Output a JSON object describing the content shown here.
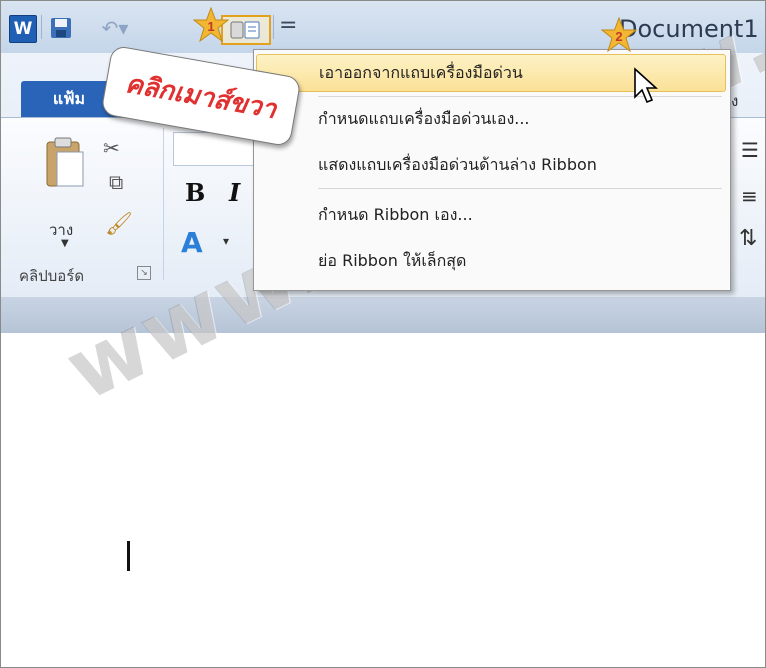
{
  "window": {
    "title": "Document1",
    "app_icon_letter": "W"
  },
  "ribbon": {
    "file_tab": "แฟ้ม",
    "right_tab_fragment": "ง",
    "clipboard": {
      "paste_label": "วาง",
      "group_label": "คลิปบอร์ด",
      "launcher_glyph": "↘"
    },
    "font": {
      "bold": "B",
      "italic": "I",
      "text_effects": "A"
    }
  },
  "context_menu": {
    "items": [
      {
        "label": "เอาออกจากแถบเครื่องมือด่วน",
        "highlighted": true
      },
      {
        "label": "กำหนดแถบเครื่องมือด่วนเอง..."
      },
      {
        "label": "แสดงแถบเครื่องมือด่วนด้านล่าง Ribbon"
      },
      {
        "label": "กำหนด Ribbon เอง..."
      },
      {
        "label": "ย่อ Ribbon ให้เล็กสุด"
      }
    ]
  },
  "callout": {
    "text": "คลิกเมาส์ขวา"
  },
  "markers": {
    "step1": "1",
    "step2": "2"
  },
  "watermark": "www.com5dow.com",
  "colors": {
    "file_tab": "#2a64b8",
    "highlight": "#fbe197",
    "callout_text": "#e03030",
    "star": "#f2b632"
  }
}
